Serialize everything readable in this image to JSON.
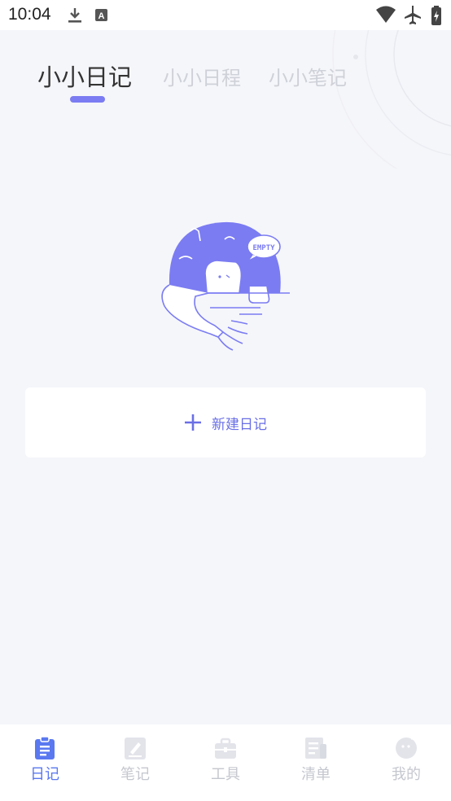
{
  "status_bar": {
    "time": "10:04"
  },
  "tabs": [
    {
      "label": "小小日记",
      "active": true
    },
    {
      "label": "小小日程",
      "active": false
    },
    {
      "label": "小小笔记",
      "active": false
    }
  ],
  "empty_state": {
    "badge_text": "EMPTY"
  },
  "new_diary": {
    "label": "新建日记"
  },
  "bottom_nav": [
    {
      "label": "日记",
      "icon": "clipboard-icon",
      "active": true
    },
    {
      "label": "笔记",
      "icon": "notebook-icon",
      "active": false
    },
    {
      "label": "工具",
      "icon": "toolbox-icon",
      "active": false
    },
    {
      "label": "清单",
      "icon": "list-icon",
      "active": false
    },
    {
      "label": "我的",
      "icon": "profile-icon",
      "active": false
    }
  ],
  "colors": {
    "accent": "#7b7cf2",
    "nav_active": "#5a78f0",
    "inactive": "#c5c7cf",
    "background": "#f5f6fa"
  }
}
